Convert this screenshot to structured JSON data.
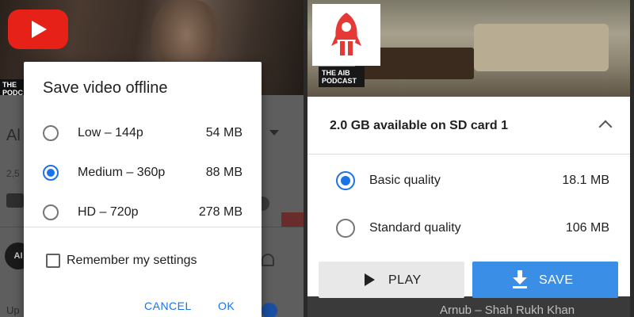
{
  "left": {
    "video": {
      "podcast_tag": "THE PODC",
      "title_fragment": "Al Kh",
      "views_fragment": "2,5",
      "channel_initials": "AI",
      "upnext_fragment": "Up"
    },
    "dialog": {
      "title": "Save video offline",
      "options": [
        {
          "label": "Low – 144p",
          "size": "54 MB",
          "selected": false
        },
        {
          "label": "Medium – 360p",
          "size": "88 MB",
          "selected": true
        },
        {
          "label": "HD – 720p",
          "size": "278 MB",
          "selected": false
        }
      ],
      "remember_label": "Remember my settings",
      "remember_checked": false,
      "cancel_label": "CANCEL",
      "ok_label": "OK"
    }
  },
  "right": {
    "video": {
      "podcast_tag": "THE AIB PODCAST"
    },
    "sheet": {
      "storage_label": "2.0 GB available on SD card 1",
      "qualities": [
        {
          "label": "Basic quality",
          "size": "18.1 MB",
          "selected": true
        },
        {
          "label": "Standard quality",
          "size": "106 MB",
          "selected": false
        }
      ],
      "play_label": "PLAY",
      "save_label": "SAVE"
    },
    "below_title": "Arnub – Shah Rukh Khan"
  },
  "colors": {
    "accent_blue": "#1a73e8",
    "save_button": "#3a8ee6",
    "youtube_red": "#e62117",
    "youtube_go_red": "#e53935"
  }
}
